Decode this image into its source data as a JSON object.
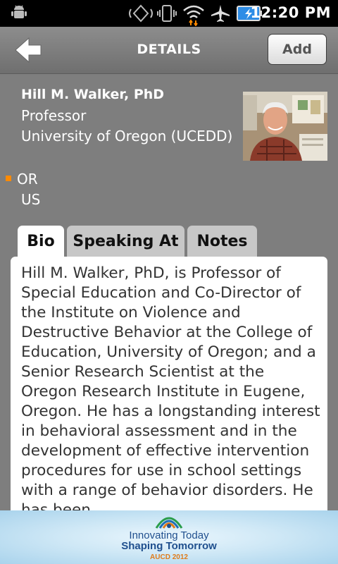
{
  "status_bar": {
    "time": "12:20 PM",
    "icons": [
      "android-debug-icon",
      "vibrate-icon",
      "phone-vibrate-icon",
      "wifi-icon",
      "airplane-icon",
      "battery-charging-icon"
    ]
  },
  "header": {
    "title": "DETAILS",
    "add_label": "Add"
  },
  "profile": {
    "name": "Hill M. Walker, PhD",
    "title": "Professor",
    "organization": "University of Oregon (UCEDD)",
    "state": "OR",
    "country": "US"
  },
  "tabs": [
    {
      "label": "Bio",
      "active": true
    },
    {
      "label": "Speaking At",
      "active": false
    },
    {
      "label": "Notes",
      "active": false
    }
  ],
  "bio": {
    "text": "Hill M. Walker, PhD, is Professor of Special Education and Co-Director of the Institute on Violence and Destructive Behavior at the College of Education, University of Oregon; and a Senior Research Scientist at the Oregon Research Institute in Eugene, Oregon. He has a longstanding interest in behavioral assessment and in the development of effective intervention procedures for use in school settings with a range of behavior disorders. He has been"
  },
  "banner": {
    "line1": "Innovating Today",
    "line2": "Shaping Tomorrow",
    "line3": "AUCD 2012"
  },
  "colors": {
    "accent": "#ff8a00",
    "background": "#7e7e7e",
    "banner_text": "#1f4f8e"
  }
}
